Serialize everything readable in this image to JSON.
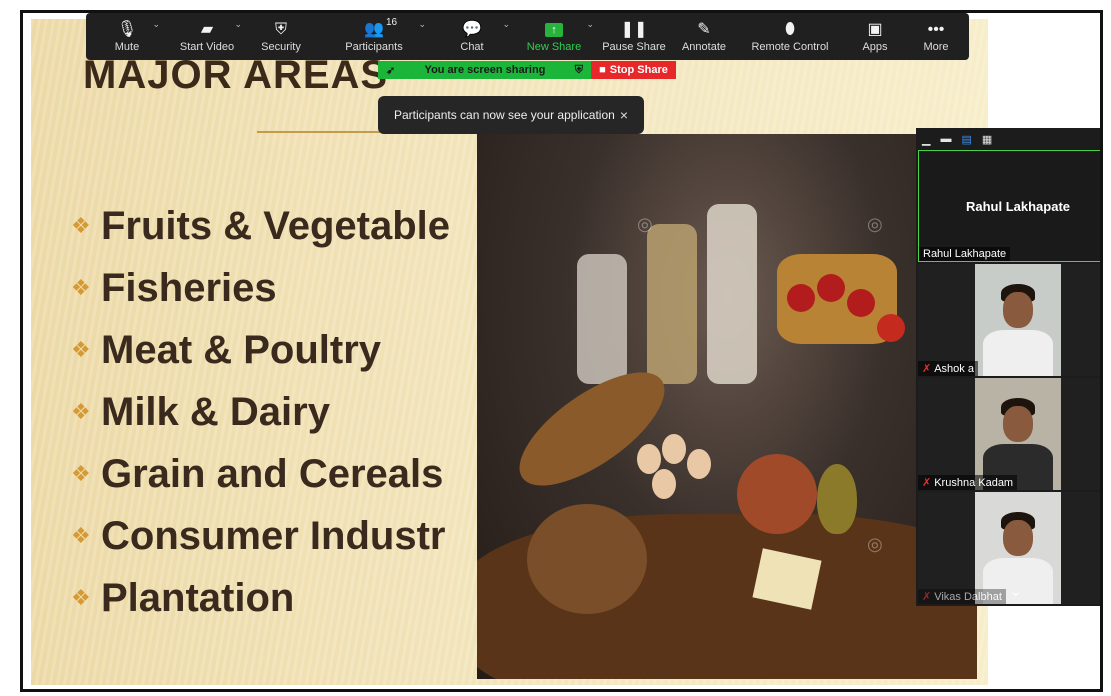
{
  "toolbar": {
    "items": [
      {
        "label": "Mute",
        "icon": "🎙"
      },
      {
        "label": "Start Video",
        "icon": "▰"
      },
      {
        "label": "Security",
        "icon": "⛨"
      },
      {
        "label": "Participants",
        "icon": "👥",
        "count": "16"
      },
      {
        "label": "Chat",
        "icon": "💬"
      },
      {
        "label": "New Share",
        "icon": "↑"
      },
      {
        "label": "Pause Share",
        "icon": "❚❚"
      },
      {
        "label": "Annotate",
        "icon": "✎"
      },
      {
        "label": "Remote Control",
        "icon": "⬮"
      },
      {
        "label": "Apps",
        "icon": "▣"
      },
      {
        "label": "More",
        "icon": "•••"
      }
    ],
    "caret": "⌄"
  },
  "share_bar": {
    "status": "You are screen sharing",
    "stop_label": "Stop Share",
    "status_color": "#1bb53a",
    "stop_color": "#e8272a"
  },
  "toast": {
    "message": "Participants can now see your application",
    "close": "×"
  },
  "slide": {
    "title": "MAJOR AREAS",
    "bullet_icon": "❖",
    "bullets": [
      "Fruits & Vegetable",
      "Fisheries",
      "Meat & Poultry",
      "Milk & Dairy",
      "Grain and Cereals",
      "Consumer Industr",
      "Plantation"
    ]
  },
  "video_panel": {
    "view_icons": [
      "▁",
      "▬",
      "▤",
      "▦"
    ],
    "speaker": {
      "name": "Rahul Lakhapate",
      "tag": "Rahul Lakhapate"
    },
    "participants": [
      {
        "name": "Ashok a",
        "muted": true
      },
      {
        "name": "Krushna Kadam",
        "muted": true
      },
      {
        "name": "Vikas Dalbhat",
        "muted": true
      }
    ],
    "expand_icon": "⌄",
    "accent": "#4ccf4a"
  }
}
